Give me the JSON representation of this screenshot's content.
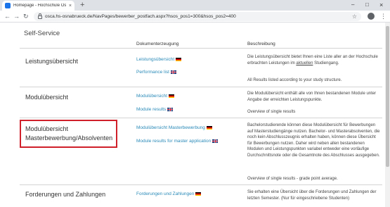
{
  "browser": {
    "tab_title": "Homepage - Hochschule Osnab...",
    "tab_close": "×",
    "new_tab": "+",
    "url": "osca.hs-osnabrueck.de/NavPages/bewerber_postfach.aspx?hsos_pos1=300&hsos_pos2=400",
    "back": "←",
    "forward": "→",
    "reload": "C",
    "minimize": "–",
    "maximize": "□",
    "star": "☆",
    "menu": "⋮"
  },
  "page": {
    "section_title": "Self-Service",
    "columns": {
      "documents": "Dokumenterzeugung",
      "description": "Beschreibung"
    },
    "rows": [
      {
        "title": "Leistungsübersicht",
        "link_de": "Leistungsübersicht",
        "link_en": "Performance list",
        "desc_1": "Die Leistungsübersicht bietet Ihnen eine Liste aller an der Hochschule erbrachten Leistungen im",
        "desc_1_link": "aktuellen",
        "desc_1_end": "Studiengang.",
        "desc_2": "All Results listed according to your study structure."
      },
      {
        "title": "Modulübersicht",
        "link_de": "Modulübersicht",
        "link_en": "Module results",
        "desc_1": "Die Modulübersicht enthält alle von Ihnen bestandenen Module unter Angabe der erreichten Leistungspunkte.",
        "desc_2": "Overview of single results"
      },
      {
        "title_line1": "Modulübersicht",
        "title_line2": "Masterbewerbung/Absolventen",
        "link_de": "Modulübersicht Masterbewerbung",
        "link_en": "Module results for master application",
        "desc_1": "Bachelorstudierende können diese Modulübersicht für Bewerbungen auf Masterstudiengänge nutzen. Bachelor- und Masterabsolventen, die noch kein Abschlusszeugnis erhalten haben, können diese Übersicht für Bewerbungen nutzen. Daher wird neben allen bestandenen Modulen und Leistungspunkten variabel entweder eine vorläufige Durchschnittsnote oder die Gesamtnote des Abschlusses ausgegeben.",
        "desc_2": "Overview of single results - grade point average."
      },
      {
        "title": "Forderungen und Zahlungen",
        "link_de": "Forderungen und Zahlungen",
        "desc_1": "Sie erhalten eine Übersicht über die Forderungen und Zahlungen der letzten Semester. (Nur für eingeschriebene Studenten)"
      }
    ]
  },
  "colors": {
    "link": "#2a8ab8",
    "highlight_border": "#d0202a",
    "rule": "#d4d4d4"
  },
  "icons": [
    "flag-germany-icon",
    "flag-uk-icon",
    "lock-icon",
    "star-icon",
    "profile-icon",
    "menu-icon"
  ]
}
